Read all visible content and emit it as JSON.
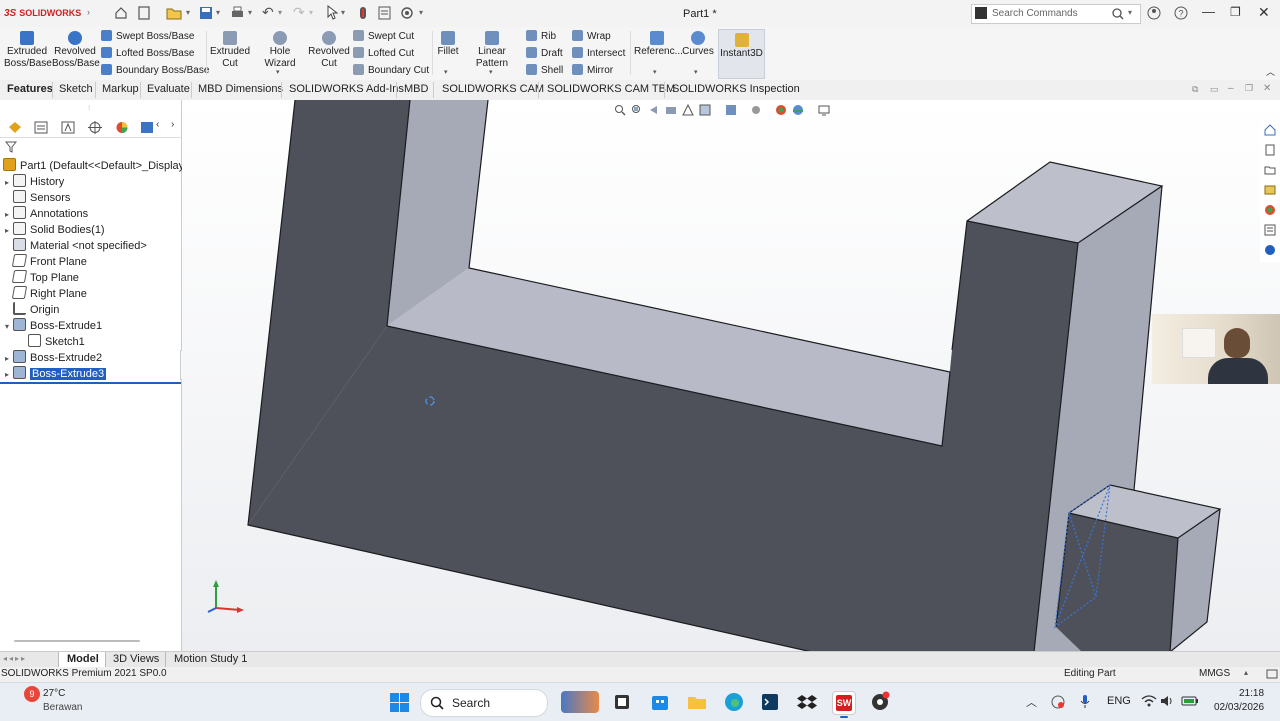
{
  "title_bar": {
    "app_logo_text": "SOLIDWORKS",
    "document_title": "Part1 *",
    "search_placeholder": "Search Commands"
  },
  "ribbon": {
    "large_buttons": [
      {
        "label": "Extruded Boss/Base",
        "icon": "extruded-boss-icon"
      },
      {
        "label": "Revolved Boss/Base",
        "icon": "revolved-boss-icon"
      },
      {
        "label": "Extruded Cut",
        "icon": "extruded-cut-icon"
      },
      {
        "label": "Hole Wizard",
        "icon": "hole-wizard-icon"
      },
      {
        "label": "Revolved Cut",
        "icon": "revolved-cut-icon"
      },
      {
        "label": "Fillet",
        "icon": "fillet-icon"
      },
      {
        "label": "Linear Pattern",
        "icon": "linear-pattern-icon"
      },
      {
        "label": "Referenc...",
        "icon": "reference-geometry-icon"
      },
      {
        "label": "Curves",
        "icon": "curves-icon"
      },
      {
        "label": "Instant3D",
        "icon": "instant3d-icon"
      }
    ],
    "small_buttons": [
      {
        "label": "Swept Boss/Base"
      },
      {
        "label": "Lofted Boss/Base"
      },
      {
        "label": "Boundary Boss/Base"
      },
      {
        "label": "Swept Cut"
      },
      {
        "label": "Lofted Cut"
      },
      {
        "label": "Boundary Cut"
      },
      {
        "label": "Rib"
      },
      {
        "label": "Draft"
      },
      {
        "label": "Shell"
      },
      {
        "label": "Wrap"
      },
      {
        "label": "Intersect"
      },
      {
        "label": "Mirror"
      }
    ]
  },
  "command_tabs": [
    "Features",
    "Sketch",
    "Markup",
    "Evaluate",
    "MBD Dimensions",
    "SOLIDWORKS Add-Ins",
    "MBD",
    "SOLIDWORKS CAM",
    "SOLIDWORKS CAM TBM",
    "SOLIDWORKS Inspection"
  ],
  "feature_tree": {
    "root": "Part1  (Default<<Default>_Display S",
    "items": [
      {
        "label": "History"
      },
      {
        "label": "Sensors"
      },
      {
        "label": "Annotations"
      },
      {
        "label": "Solid Bodies(1)"
      },
      {
        "label": "Material <not specified>"
      },
      {
        "label": "Front Plane"
      },
      {
        "label": "Top Plane"
      },
      {
        "label": "Right Plane"
      },
      {
        "label": "Origin"
      },
      {
        "label": "Boss-Extrude1"
      },
      {
        "label": "Sketch1"
      },
      {
        "label": "Boss-Extrude2"
      },
      {
        "label": "Boss-Extrude3"
      }
    ]
  },
  "bottom_tabs": [
    "Model",
    "3D Views",
    "Motion Study 1"
  ],
  "status_bar": {
    "product": "SOLIDWORKS Premium 2021 SP0.0",
    "mode": "Editing Part",
    "units": "MMGS"
  },
  "taskbar": {
    "weather_temp": "27°C",
    "weather_desc": "Berawan",
    "weather_badge": "9",
    "search_label": "Search",
    "language": "ENG",
    "time": "21:18",
    "date": "02/03/2026"
  },
  "colors": {
    "accent": "#1f5fbf",
    "part_dark": "#4e5159",
    "part_light": "#a6a9b6",
    "part_top": "#bdc0cb",
    "selection": "#3a74d6"
  }
}
